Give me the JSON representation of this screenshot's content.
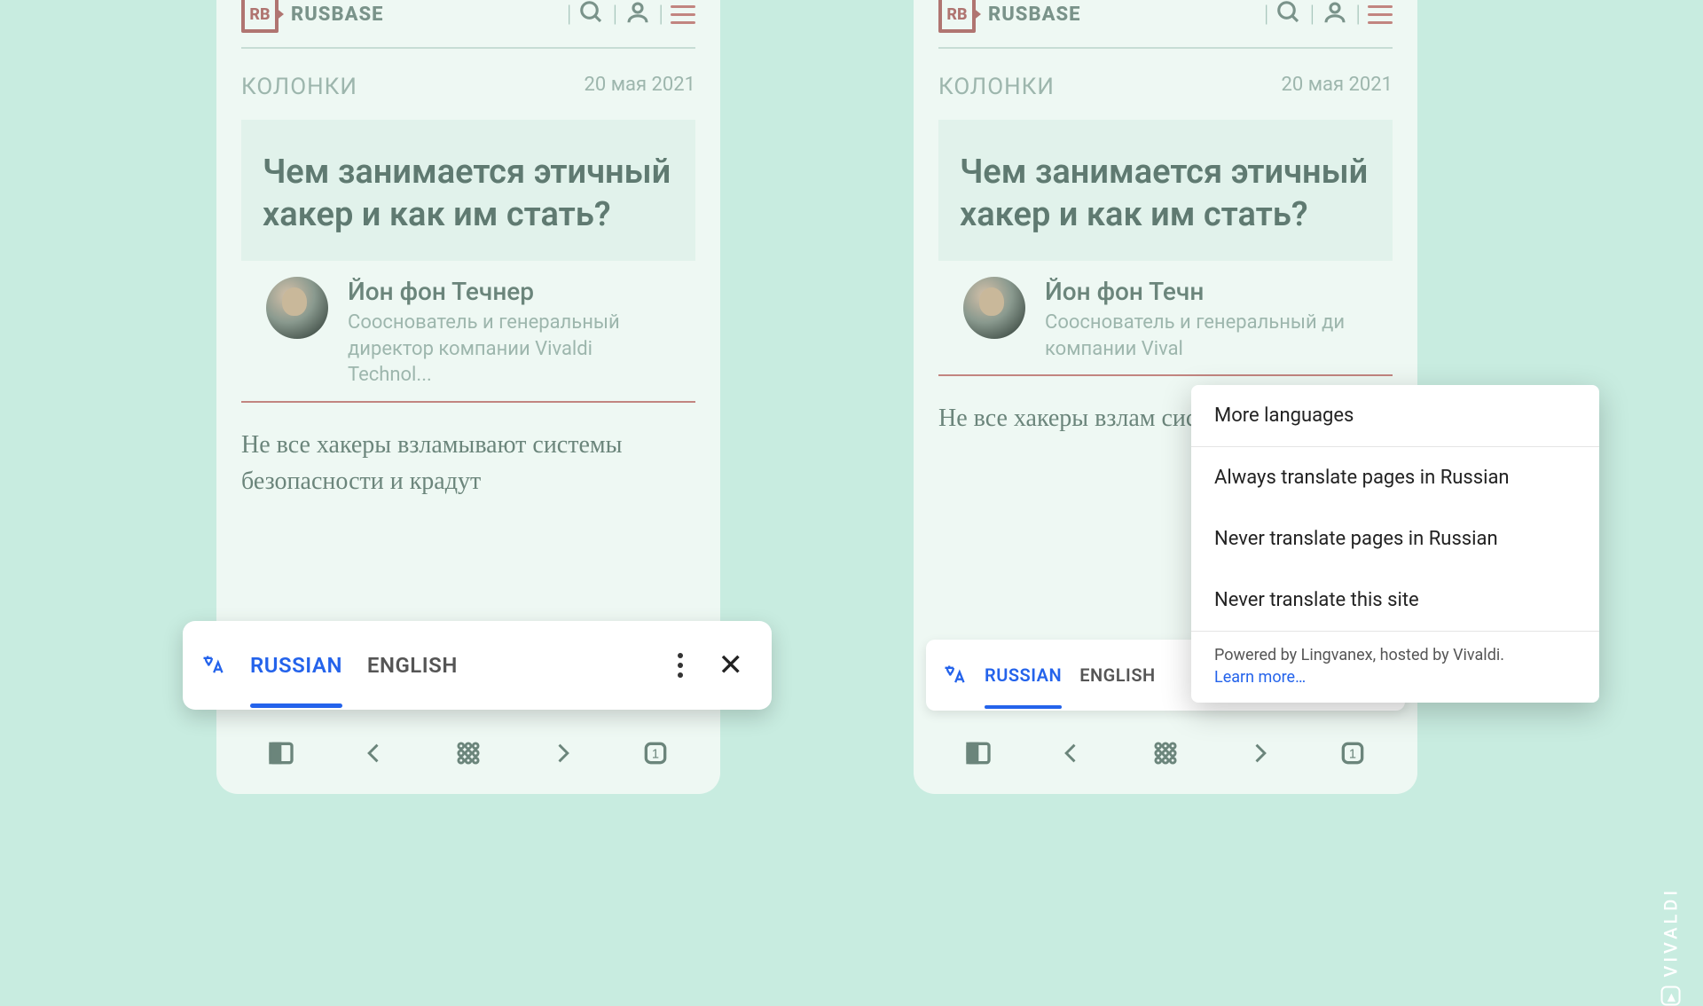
{
  "site": {
    "logo_abbr": "RB",
    "logo_name": "RUSBASE"
  },
  "article": {
    "category": "КОЛОНКИ",
    "date": "20 мая 2021",
    "title": "Чем занимается этичный хакер и как им стать?",
    "author_name": "Йон фон Течнер",
    "author_role_full": "Сооснователь и генеральный директор компании Vivaldi Technol...",
    "author_role_cut": "Сооснователь и генеральный ди компании Vival",
    "body_full": "Не все хакеры взламывают системы безопасности и крадут",
    "body_cut": "Не все хакеры взлам системы безопасност"
  },
  "translate_bar": {
    "lang_source": "RUSSIAN",
    "lang_target": "ENGLISH",
    "lang_target_cut": "ENGLISH"
  },
  "popup": {
    "more_languages": "More languages",
    "always": "Always translate pages in Russian",
    "never_lang": "Never translate pages in Russian",
    "never_site": "Never translate this site",
    "powered": "Powered by Lingvanex, hosted by Vivaldi.",
    "learn_more": "Learn more…"
  },
  "brand_watermark": "VIVALDI",
  "nav_tab_count": "1"
}
